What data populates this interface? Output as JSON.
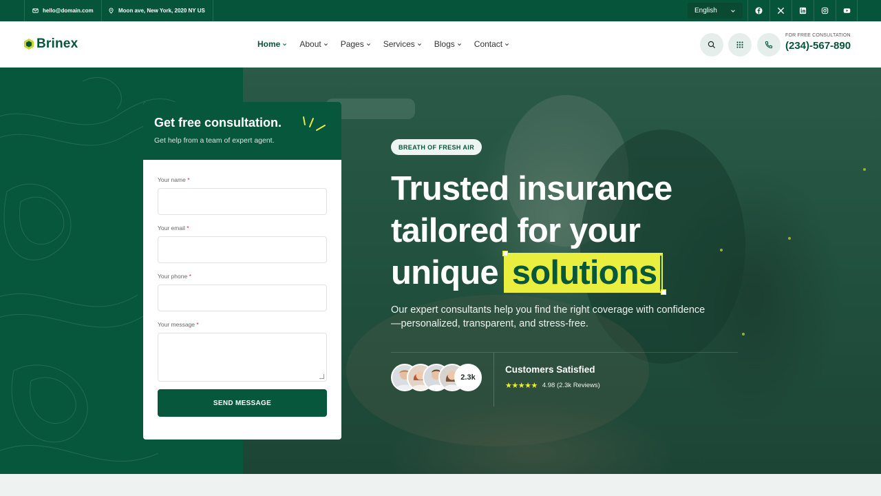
{
  "topbar": {
    "email": "hello@domain.com",
    "address": "Moon ave, New York, 2020 NY US",
    "language": "English",
    "social": [
      "facebook-icon",
      "x-icon",
      "linkedin-icon",
      "instagram-icon",
      "youtube-icon"
    ]
  },
  "header": {
    "logo": "Brinex",
    "nav": [
      {
        "label": "Home",
        "active": true
      },
      {
        "label": "About"
      },
      {
        "label": "Pages"
      },
      {
        "label": "Services"
      },
      {
        "label": "Blogs"
      },
      {
        "label": "Contact"
      }
    ],
    "call_label": "FOR FREE CONSULTATION",
    "call_number": "(234)-567-890"
  },
  "form": {
    "title": "Get free consultation.",
    "subtitle": "Get help from a team of expert agent.",
    "fields": [
      {
        "label": "Your name",
        "required": "*"
      },
      {
        "label": "Your email",
        "required": "*"
      },
      {
        "label": "Your phone",
        "required": "*"
      },
      {
        "label": "Your message",
        "required": "*"
      }
    ],
    "submit": "SEND MESSAGE"
  },
  "hero": {
    "tag": "BREATH OF FRESH AIR",
    "headline_line1": "Trusted insurance",
    "headline_line2": "tailored for your",
    "headline_line3": "unique",
    "headline_highlight": "solutions",
    "subtext": "Our expert consultants help you find the right coverage with confidence—personalized, transparent, and stress-free.",
    "customers_count": "2.3k",
    "customers_title": "Customers Satisfied",
    "stars": "★★★★★",
    "rating_text": "4.98 (2.3k Reviews)"
  },
  "colors": {
    "brand": "#06543a",
    "accent": "#e9ee3f"
  }
}
